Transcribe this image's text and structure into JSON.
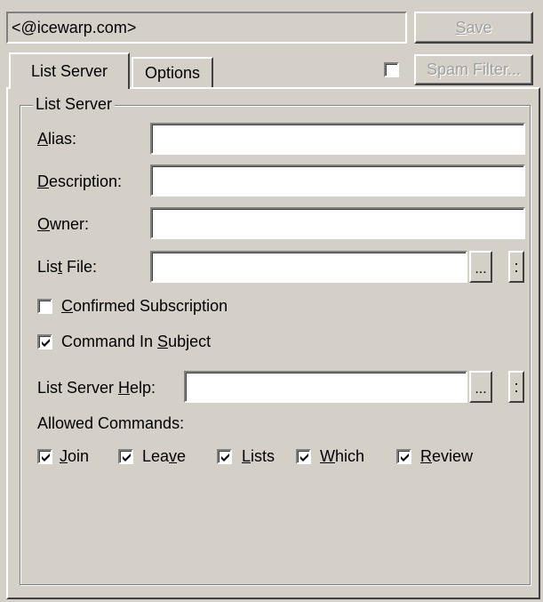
{
  "header": {
    "email_display": "<@icewarp.com>",
    "save_label": "Save",
    "spam_filter_label": "Spam Filter..."
  },
  "tabs": [
    {
      "label": "List Server",
      "active": true
    },
    {
      "label": "Options",
      "active": false
    }
  ],
  "spam_filter_checked": false,
  "group": {
    "legend": "List Server",
    "alias": {
      "label": "Alias:",
      "value": ""
    },
    "description": {
      "label": "Description:",
      "value": ""
    },
    "owner": {
      "label": "Owner:",
      "value": ""
    },
    "list_file": {
      "label": "List File:",
      "value": "",
      "browse": "...",
      "more": ":"
    },
    "confirmed_subscription": {
      "label": "Confirmed Subscription",
      "checked": false
    },
    "command_in_subject": {
      "label": "Command In Subject",
      "checked": true
    },
    "list_server_help": {
      "label": "List Server Help:",
      "value": "",
      "browse": "...",
      "more": ":"
    },
    "allowed_commands_label": "Allowed Commands:",
    "allowed_commands": [
      {
        "label": "Join",
        "checked": true
      },
      {
        "label": "Leave",
        "checked": true
      },
      {
        "label": "Lists",
        "checked": true
      },
      {
        "label": "Which",
        "checked": true
      },
      {
        "label": "Review",
        "checked": true
      }
    ]
  }
}
